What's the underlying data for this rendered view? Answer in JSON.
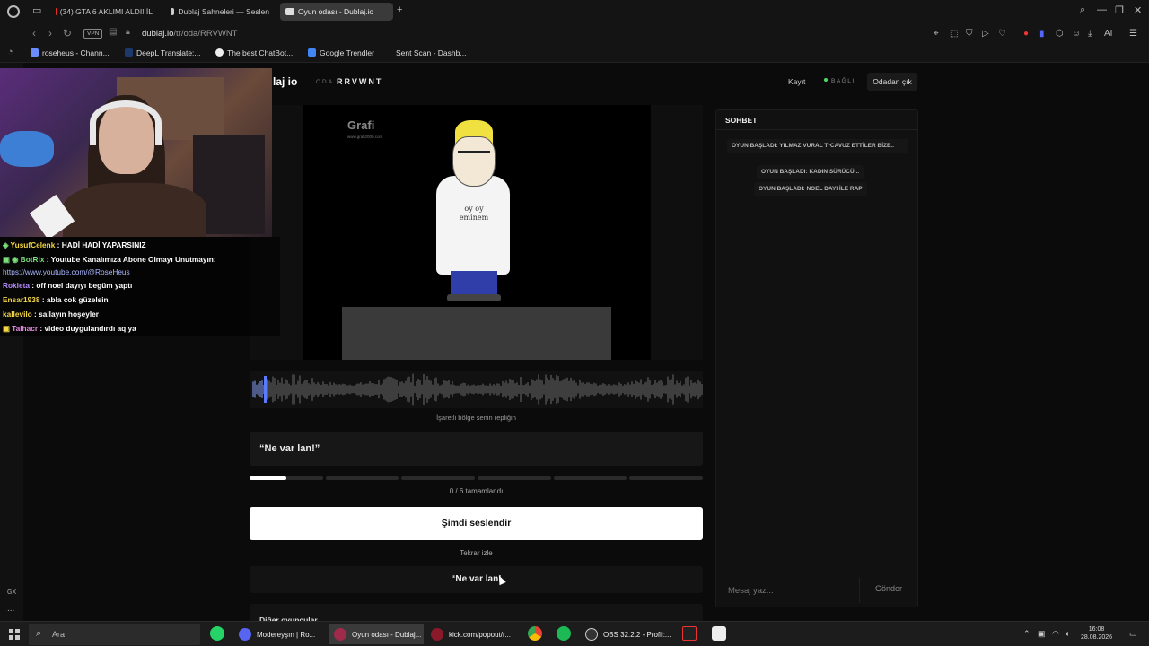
{
  "browser": {
    "tabs": [
      {
        "label": "(34) GTA 6 AKLIMI ALDI! İL",
        "active": false,
        "icon": "youtube-icon"
      },
      {
        "label": "Dublaj Sahneleri — Seslen",
        "active": false,
        "icon": "dublaj-icon"
      },
      {
        "label": "Oyun odası - Dublaj.io",
        "active": true,
        "icon": "dublaj-icon"
      }
    ],
    "new_tab": "+",
    "vpn": "VPN",
    "url_host": "dublaj.io",
    "url_path": "/tr/oda/RRVWNT",
    "ai_label": "AI",
    "bookmarks": [
      "roseheus - Chann...",
      "DeepL Translate:...",
      "The best ChatBot...",
      "Google Trendler",
      "Sent Scan - Dashb..."
    ]
  },
  "stream_chat": [
    {
      "user": "YusufCelenk",
      "sep": " : ",
      "text": "HADİ HADİ YAPARSINIZ",
      "color": "#f5d742"
    },
    {
      "user": "BotRix",
      "sep": " : ",
      "text": "Youtube Kanalımıza Abone Olmayı Unutmayın:",
      "color": "#7be07b"
    },
    {
      "user": "",
      "sep": "",
      "text": "https://www.youtube.com/@RoseHeus",
      "color": "#aab7ff"
    },
    {
      "user": "Rokleta",
      "sep": " : ",
      "text": "off noel dayıyı begüm yaptı",
      "color": "#b28cff"
    },
    {
      "user": "Ensar1938",
      "sep": " : ",
      "text": "abla cok güzelsin",
      "color": "#f5d742"
    },
    {
      "user": "kallevilo",
      "sep": " : ",
      "text": "sallayın hoşeyler",
      "color": "#f5d742"
    },
    {
      "user": "Talhacr",
      "sep": " : ",
      "text": "video duygulandırdı aq ya",
      "color": "#e58ae0"
    }
  ],
  "header": {
    "logo": "laj io",
    "room_label": "ODA",
    "room_code": "RRVWNT",
    "record_link": "Kayıt",
    "status": "BAĞLI",
    "leave": "Odadan çık"
  },
  "video": {
    "watermark": "Grafi",
    "watermark_sub": "www.grafi2000.com",
    "shirt_text": "oy oy\neminem"
  },
  "waveform": {
    "caption": "İşaretli bölge senin repliğin"
  },
  "line": {
    "text": "“Ne var lan!”"
  },
  "progress": {
    "done": 0,
    "total": 6,
    "text": "0 / 6 tamamlandı",
    "current_fraction": 0.5
  },
  "buttons": {
    "record": "Şimdi seslendir",
    "replay": "Tekrar izle",
    "quote": "“Ne var lan!",
    "others": "Diğer oyuncular"
  },
  "chat": {
    "title": "SOHBET",
    "messages": [
      "OYUN BAŞLADI: YILMAZ VURAL T*CAVUZ ETTİLER BİZE..",
      "OYUN BAŞLADI: KADIN SÜRÜCÜ...",
      "OYUN BAŞLADI: NOEL DAYI İLE RAP"
    ],
    "placeholder": "Mesaj yaz...",
    "send": "Gönder"
  },
  "sidebar": {
    "gx": "GX",
    "more": "..."
  },
  "taskbar": {
    "search_placeholder": "Ara",
    "items": [
      {
        "label": "Modereyşın | Ro...",
        "icon": "discord-icon",
        "active": false
      },
      {
        "label": "Oyun odası - Dublaj...",
        "icon": "opera-icon",
        "active": true
      },
      {
        "label": "kick.com/popout/r...",
        "icon": "opera-icon",
        "active": false
      },
      {
        "label": "OBS 32.2.2 - Profil:...",
        "icon": "obs-icon",
        "active": false
      }
    ],
    "time": "16:08",
    "date": "28.08.2026"
  },
  "colors": {
    "accent": "#ffffff",
    "status_ok": "#4cd964",
    "brand_tab": "#3a3a3a"
  }
}
